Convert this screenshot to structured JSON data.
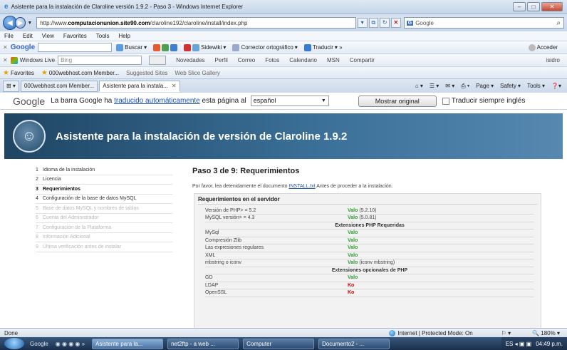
{
  "window": {
    "title": "Asistente para la instalación de Claroline versión 1.9.2 - Paso 3 - Windows Internet Explorer"
  },
  "address": {
    "prefix": "http://www.",
    "domain": "computacionunion.site90.com",
    "path": "/claroline192/claroline/install/index.php"
  },
  "search": {
    "value": "Google"
  },
  "menu": [
    "File",
    "Edit",
    "View",
    "Favorites",
    "Tools",
    "Help"
  ],
  "google_toolbar": {
    "logo": "Google",
    "buttons": [
      "Buscar",
      "Sidewiki",
      "Corrector ortográfico",
      "Traducir",
      "Acceder"
    ]
  },
  "live_toolbar": {
    "logo": "Windows Live",
    "search_value": "Bing",
    "links": [
      "Novedades",
      "Perfil",
      "Correo",
      "Fotos",
      "Calendario",
      "MSN",
      "Compartir"
    ],
    "user": "isidro"
  },
  "favorites_bar": {
    "label": "Favorites",
    "items": [
      "000webhost.com Member...",
      "Suggested Sites",
      "Web Slice Gallery"
    ]
  },
  "tabs": [
    {
      "label": "000webhost.com Member...",
      "active": false
    },
    {
      "label": "Asistente para la instala...",
      "active": true
    }
  ],
  "command_bar": [
    "Page",
    "Safety",
    "Tools"
  ],
  "translate_bar": {
    "logo": "Google",
    "msg_before": "La barra Google ha ",
    "msg_link": "traducido automáticamente",
    "msg_after": " esta página al",
    "language": "español",
    "show_original": "Mostrar original",
    "always_translate": "Traducir siempre inglés"
  },
  "banner": {
    "title": "Asistente para la instalación de versión de Claroline 1.9.2"
  },
  "steps": [
    {
      "num": "1",
      "label": "Idioma de la instalación",
      "state": "done"
    },
    {
      "num": "2",
      "label": "Licencia",
      "state": "done"
    },
    {
      "num": "3",
      "label": "Requerimientos",
      "state": "current"
    },
    {
      "num": "4",
      "label": "Configuración de la base de datos MySQL",
      "state": "pending"
    },
    {
      "num": "5",
      "label": "Base de datos MySQL y nombres de tablas",
      "state": "disabled"
    },
    {
      "num": "6",
      "label": "Cuenta del Administrador",
      "state": "disabled"
    },
    {
      "num": "7",
      "label": "Configuración de la Plataforma",
      "state": "disabled"
    },
    {
      "num": "8",
      "label": "Información Adicional",
      "state": "disabled"
    },
    {
      "num": "9",
      "label": "Última verificación antes de instalar",
      "state": "disabled"
    }
  ],
  "main": {
    "heading": "Paso 3 de 9: Requerimientos",
    "intro_before": "Por favor, lea detenidamente el documento ",
    "intro_link": "INSTALL.txt",
    "intro_after": " Antes de proceder a la instalación.",
    "box_title": "Requerimientos en el servidor"
  },
  "requirements": [
    {
      "label": "Versión de PHP> = 5.2",
      "status": "Valo",
      "detail": "(5.2.10)",
      "ok": true
    },
    {
      "label": "MySQL versión> = 4.3",
      "status": "Valo",
      "detail": "(5.0.81)",
      "ok": true
    },
    {
      "section": "Extensiones PHP Requeridas"
    },
    {
      "label": "MySql",
      "status": "Valo",
      "detail": "",
      "ok": true
    },
    {
      "label": "Compresión Zlib",
      "status": "Valo",
      "detail": "",
      "ok": true
    },
    {
      "label": "Las expresiones regulares",
      "status": "Valo",
      "detail": "",
      "ok": true
    },
    {
      "label": "XML",
      "status": "Valo",
      "detail": "",
      "ok": true
    },
    {
      "label": "mbstring o iconv",
      "status": "Valo",
      "detail": "(iconv mbstring)",
      "ok": true
    },
    {
      "section": "Extensiones opcionales de PHP"
    },
    {
      "label": "GD",
      "status": "Valo",
      "detail": "",
      "ok": true
    },
    {
      "label": "LDAP",
      "status": "Ko",
      "detail": "",
      "ok": false
    },
    {
      "label": "OpenSSL",
      "status": "Ko",
      "detail": "",
      "ok": false
    }
  ],
  "statusbar": {
    "left": "Done",
    "zone": "Internet | Protected Mode: On",
    "zoom": "180%"
  },
  "taskbar": {
    "items": [
      {
        "label": "Asistente para la...",
        "active": true
      },
      {
        "label": "net2ftp - a web ...",
        "active": false
      },
      {
        "label": "Computer",
        "active": false
      },
      {
        "label": "Documento2 - ...",
        "active": false
      }
    ],
    "clock": "04:49 p.m."
  },
  "colors": {
    "ok": "#339933",
    "ko": "#cc0000",
    "banner": "#2b5679",
    "link": "#2255bb"
  }
}
